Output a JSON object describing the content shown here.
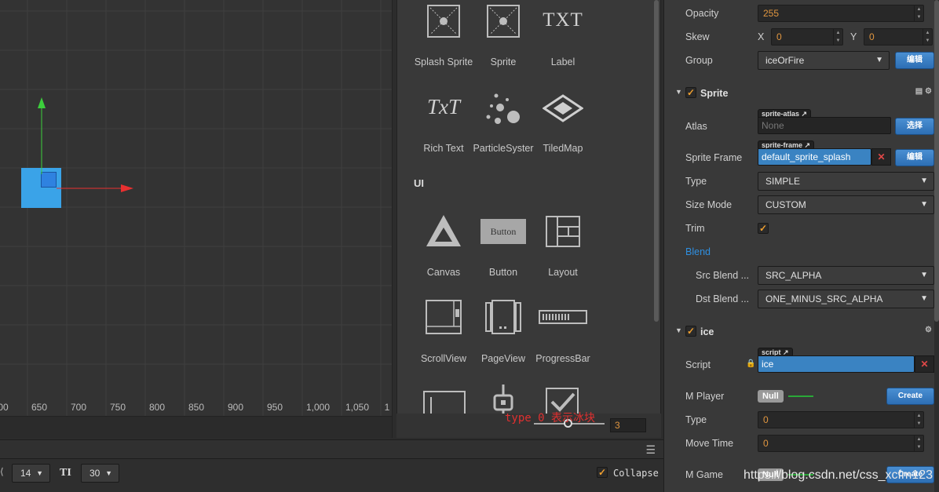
{
  "scene": {
    "ruler_ticks": [
      "00",
      "650",
      "700",
      "750",
      "800",
      "850",
      "900",
      "950",
      "1,000",
      "1,050",
      "1"
    ]
  },
  "library": {
    "items": [
      {
        "label": "Splash Sprite",
        "icon": "splash-sprite-icon"
      },
      {
        "label": "Sprite",
        "icon": "sprite-icon"
      },
      {
        "label": "Label",
        "icon": "label-icon",
        "glyph": "TXT"
      },
      {
        "label": "Rich Text",
        "icon": "rich-text-icon",
        "glyph": "TxT"
      },
      {
        "label": "ParticleSyster",
        "icon": "particle-system-icon"
      },
      {
        "label": "TiledMap",
        "icon": "tiledmap-icon"
      },
      {
        "label": "Canvas",
        "icon": "canvas-icon"
      },
      {
        "label": "Button",
        "icon": "button-icon",
        "glyph": "Button"
      },
      {
        "label": "Layout",
        "icon": "layout-icon"
      },
      {
        "label": "ScrollView",
        "icon": "scrollview-icon"
      },
      {
        "label": "PageView",
        "icon": "pageview-icon"
      },
      {
        "label": "ProgressBar",
        "icon": "progressbar-icon"
      }
    ],
    "ui_header": "UI",
    "overlay_text": "type 0 表示冰块",
    "slider_value": "3"
  },
  "console": {
    "font_size": "14",
    "ti_label": "TI",
    "line_height": "30",
    "collapse_label": "Collapse"
  },
  "inspector": {
    "opacity_label": "Opacity",
    "opacity_value": "255",
    "skew_label": "Skew",
    "skew_x_label": "X",
    "skew_x_value": "0",
    "skew_y_label": "Y",
    "skew_y_value": "0",
    "group_label": "Group",
    "group_value": "iceOrFire",
    "group_button": "编辑",
    "sprite_section": "Sprite",
    "atlas_label": "Atlas",
    "atlas_tag": "sprite-atlas",
    "atlas_value": "None",
    "atlas_button": "选择",
    "sprite_frame_label": "Sprite Frame",
    "sprite_frame_tag": "sprite-frame",
    "sprite_frame_value": "default_sprite_splash",
    "sprite_frame_button": "编辑",
    "type_label": "Type",
    "type_value": "SIMPLE",
    "size_mode_label": "Size Mode",
    "size_mode_value": "CUSTOM",
    "trim_label": "Trim",
    "blend_label": "Blend",
    "src_blend_label": "Src Blend ...",
    "src_blend_value": "SRC_ALPHA",
    "dst_blend_label": "Dst Blend ...",
    "dst_blend_value": "ONE_MINUS_SRC_ALPHA",
    "ice_section": "ice",
    "script_label": "Script",
    "script_tag": "script",
    "script_value": "ice",
    "m_player_label": "M Player",
    "m_player_value": "Null",
    "m_player_button": "Create",
    "ice_type_label": "Type",
    "ice_type_value": "0",
    "move_time_label": "Move Time",
    "move_time_value": "0",
    "m_game_label": "M Game",
    "m_game_value": "Null",
    "m_game_button": "Create",
    "accent_color": "#2e88d8",
    "blend_color": "#2f8fe0"
  },
  "watermark": "https://blog.csdn.net/css_xcfm123"
}
